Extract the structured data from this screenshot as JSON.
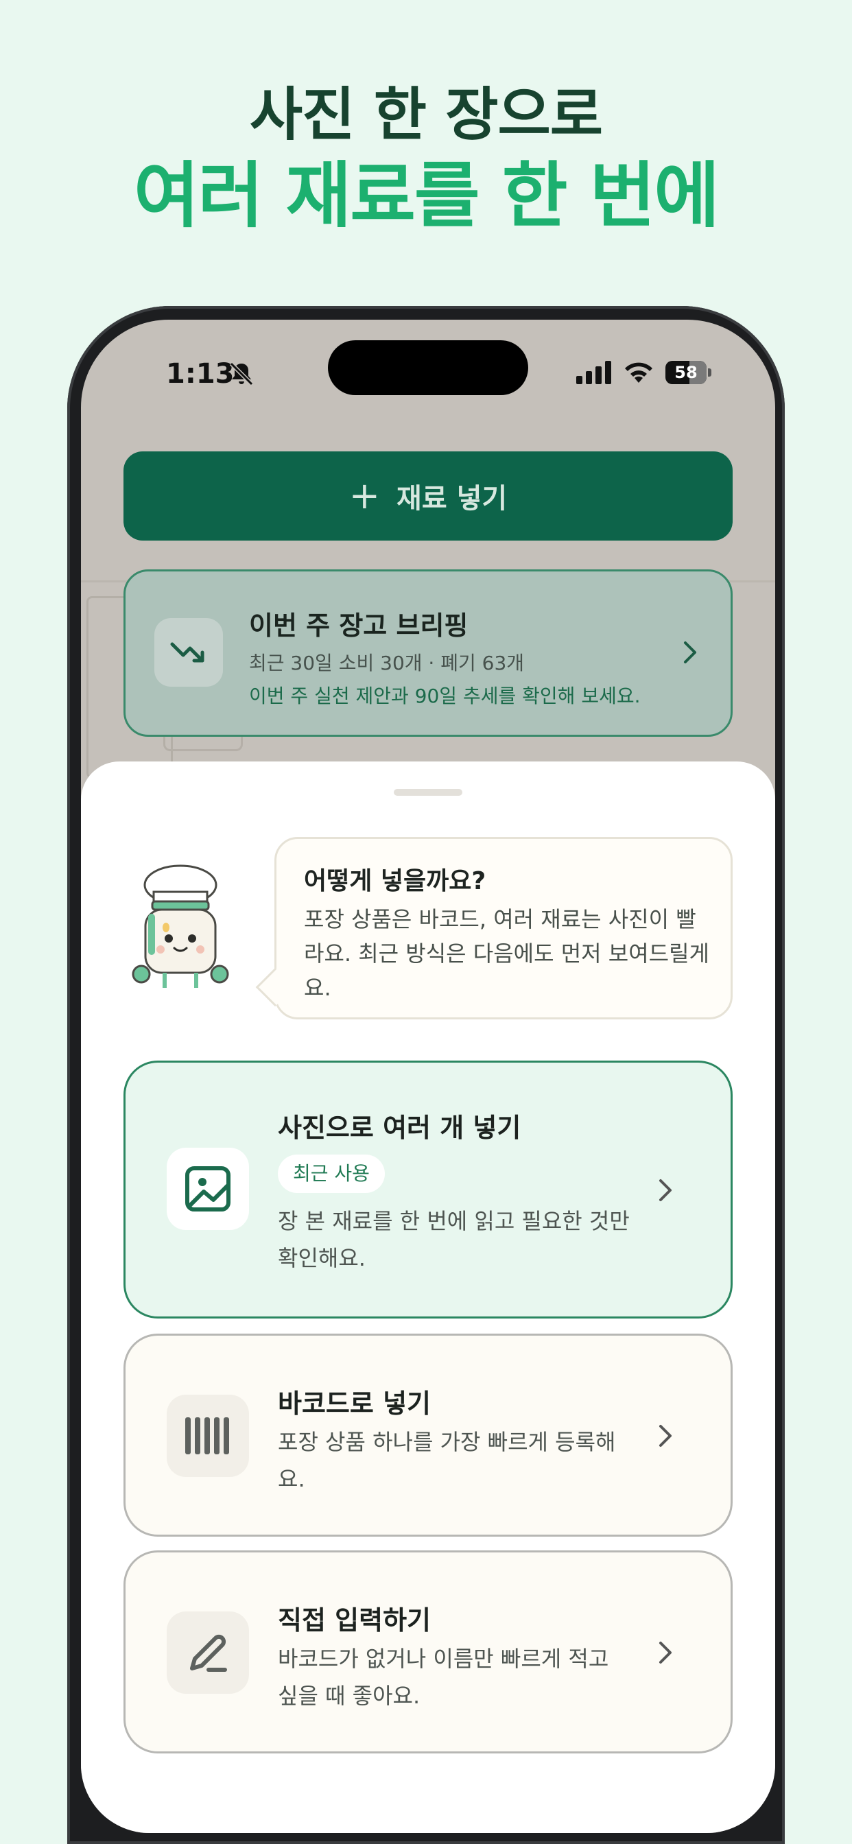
{
  "headline": {
    "line1": "사진 한 장으로",
    "line2": "여러 재료를 한 번에"
  },
  "status_bar": {
    "time": "1:13",
    "battery": "58",
    "battery_level": 0.58,
    "icons": [
      "bell-slash-icon",
      "signal-icon",
      "wifi-icon",
      "battery-icon"
    ]
  },
  "add_button": {
    "icon": "plus-icon",
    "label": "재료 넣기"
  },
  "briefing": {
    "icon": "trend-down-icon",
    "title": "이번 주 장고 브리핑",
    "subtitle": "최근 30일 소비 30개 · 폐기 63개",
    "hint": "이번 주 실천 제안과 90일 추세를 확인해 보세요."
  },
  "sheet": {
    "bubble": {
      "title": "어떻게 넣을까요?",
      "body": "포장 상품은 바코드, 여러 재료는 사진이 빨라요. 최근 방식은 다음에도 먼저 보여드릴게요."
    },
    "options": [
      {
        "icon": "image-icon",
        "title": "사진으로 여러 개 넣기",
        "badge": "최근 사용",
        "description": "장 본 재료를 한 번에 읽고 필요한 것만 확인해요."
      },
      {
        "icon": "barcode-icon",
        "title": "바코드로 넣기",
        "description": "포장 상품 하나를 가장 빠르게 등록해요."
      },
      {
        "icon": "pencil-icon",
        "title": "직접 입력하기",
        "description": "바코드가 없거나 이름만 빠르게 적고 싶을 때 좋아요."
      }
    ]
  },
  "colors": {
    "background": "#e9f8f0",
    "headline_dark": "#17432f",
    "headline_accent": "#1cb06f",
    "primary_button": "#0d644a",
    "selected_border": "#2b8761"
  }
}
